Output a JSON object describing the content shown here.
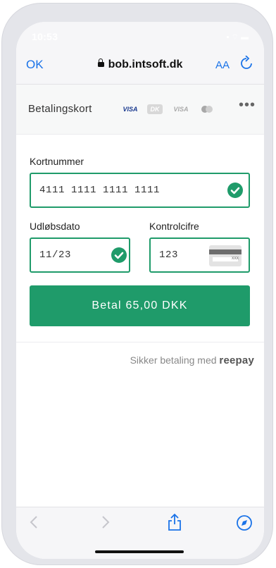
{
  "status": {
    "time": "10:53",
    "icons": "▪ ⌔ ▬"
  },
  "browser": {
    "ok_label": "OK",
    "url": "bob.intsoft.dk",
    "aa_label": "AA"
  },
  "payment": {
    "method_title": "Betalingskort",
    "card_logos": [
      "VISA",
      "DK",
      "VISA",
      "MC"
    ],
    "card_number_label": "Kortnummer",
    "card_number_value": "4111 1111 1111 1111",
    "expiry_label": "Udløbsdato",
    "expiry_value": "11/23",
    "cvc_label": "Kontrolcifre",
    "cvc_value": "123",
    "cvc_card_text": "XXX",
    "pay_button": "Betal 65,00 DKK",
    "secure_text": "Sikker betaling med",
    "secure_brand": "reepay"
  },
  "colors": {
    "accent": "#1f9b6a",
    "link": "#1a73e8"
  },
  "icons": [
    "lock-icon",
    "reload-icon",
    "more-icon",
    "check-icon",
    "cvc-card-icon",
    "back-icon",
    "forward-icon",
    "share-icon",
    "compass-icon"
  ]
}
